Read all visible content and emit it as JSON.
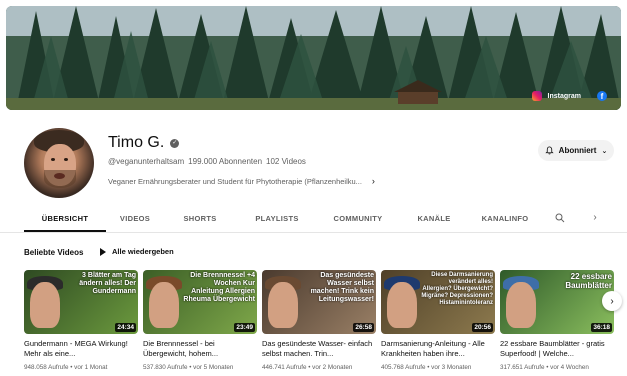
{
  "banner": {
    "instagram_label": "Instagram",
    "instagram_icon": "instagram-icon",
    "facebook_icon": "facebook-icon"
  },
  "channel": {
    "name": "Timo G.",
    "handle": "@veganunterhaltsam",
    "subscribers": "199.000 Abonnenten",
    "video_count": "102 Videos",
    "description": "Veganer Ernährungsberater und Student für Phytotherapie (Pflanzenheilku..."
  },
  "subscribe": {
    "label": "Abonniert"
  },
  "tabs": [
    {
      "label": "ÜBERSICHT",
      "active": true
    },
    {
      "label": "VIDEOS"
    },
    {
      "label": "SHORTS"
    },
    {
      "label": "PLAYLISTS"
    },
    {
      "label": "COMMUNITY"
    },
    {
      "label": "KANÄLE"
    },
    {
      "label": "KANALINFO"
    }
  ],
  "section": {
    "title": "Beliebte Videos",
    "play_all": "Alle wiedergeben"
  },
  "videos": [
    {
      "title": "Gundermann - MEGA Wirkung! Mehr als eine...",
      "meta": "948.058 Aufrufe • vor 1 Monat",
      "duration": "24:34",
      "overlay": "3 Blätter am Tag ändern alles! Der Gundermann",
      "colors": {
        "bg": "#3f6a2e",
        "accent": "#1e4d8c"
      }
    },
    {
      "title": "Die Brennnessel - bei Übergewicht, hohem...",
      "meta": "537.830 Aufrufe • vor 5 Monaten",
      "duration": "23:49",
      "overlay": "Die Brennnessel +4 Wochen Kur Anleitung Allergien Rheuma Übergewicht",
      "colors": {
        "bg": "#4e7a2f",
        "accent": "#c62828"
      }
    },
    {
      "title": "Das gesündeste Wasser- einfach selbst machen. Trin...",
      "meta": "446.741 Aufrufe • vor 2 Monaten",
      "duration": "26:58",
      "overlay": "Das gesündeste Wasser selbst machen! Trink kein Leitungswasser!",
      "colors": {
        "bg": "#5a4a3c",
        "accent": "#1565c0"
      }
    },
    {
      "title": "Darmsanierung-Anleitung - Alle Krankheiten haben ihre...",
      "meta": "405.768 Aufrufe • vor 3 Monaten",
      "duration": "20:56",
      "overlay": "Diese Darmsanierung verändert alles! Allergien? Übergewicht? Migräne? Depressionen? Histaminintoleranz",
      "colors": {
        "bg": "#6b5a3e",
        "accent": "#283593"
      }
    },
    {
      "title": "22 essbare Baumblätter - gratis Superfood! | Welche...",
      "meta": "317.651 Aufrufe • vor 4 Wochen",
      "duration": "36:18",
      "overlay": "22 essbare Baumblätter",
      "colors": {
        "bg": "#4f7d3a",
        "accent": "#0277bd"
      }
    }
  ]
}
